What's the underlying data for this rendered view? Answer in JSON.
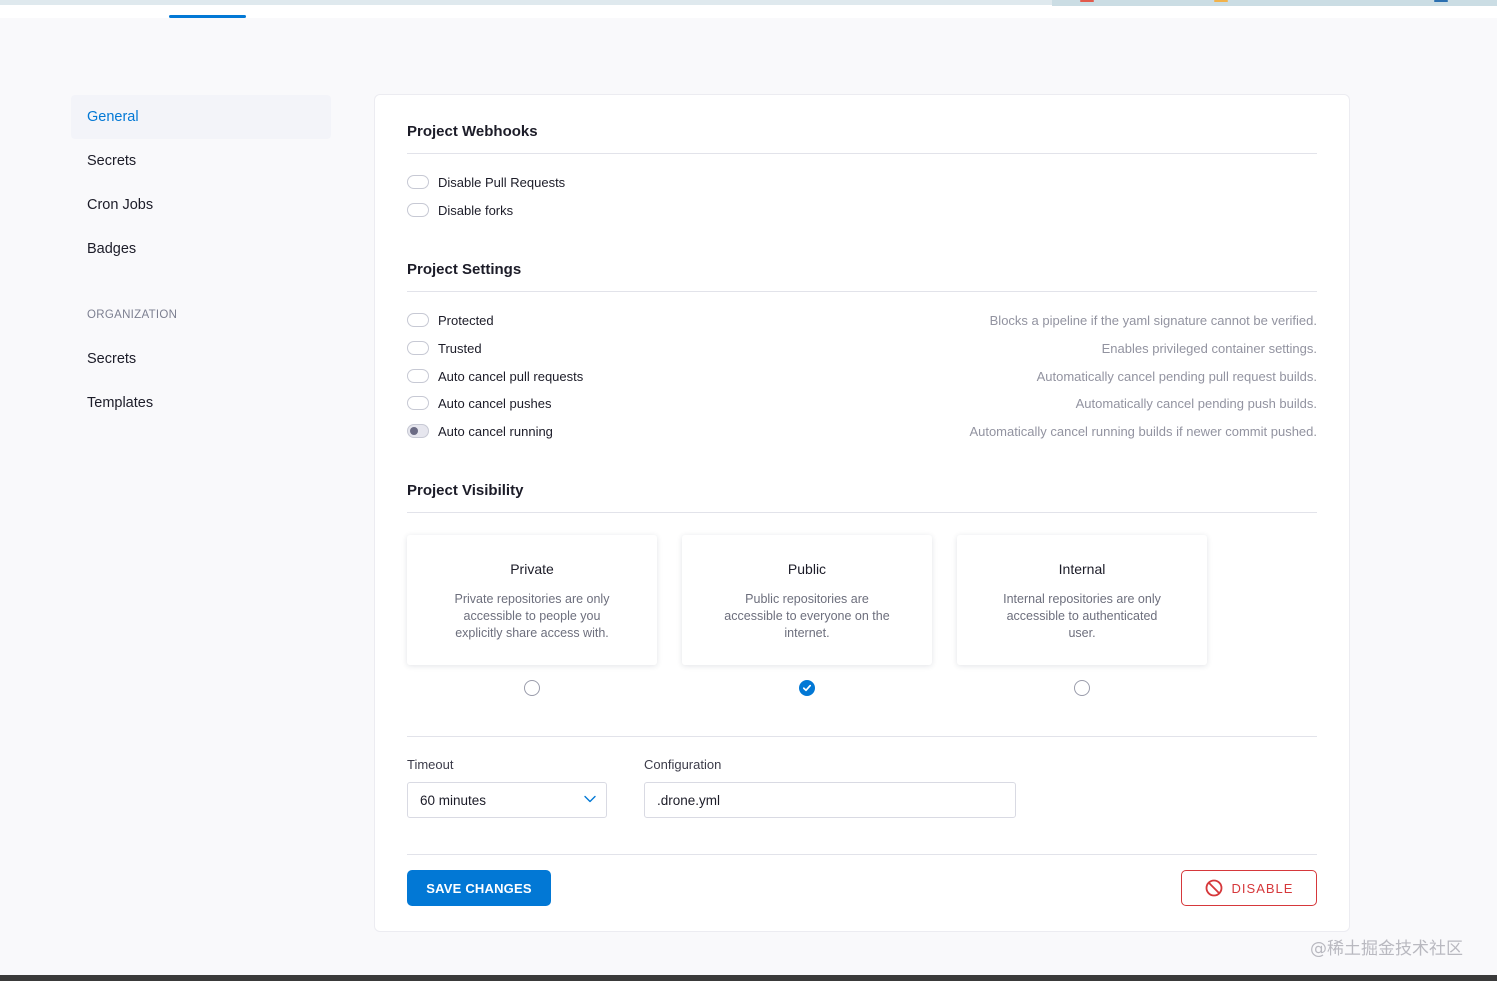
{
  "sidebar": {
    "items": [
      {
        "label": "General",
        "active": true
      },
      {
        "label": "Secrets"
      },
      {
        "label": "Cron Jobs"
      },
      {
        "label": "Badges"
      }
    ],
    "org_heading": "ORGANIZATION",
    "org_items": [
      {
        "label": "Secrets"
      },
      {
        "label": "Templates"
      }
    ]
  },
  "webhooks": {
    "title": "Project Webhooks",
    "toggles": [
      {
        "label": "Disable Pull Requests",
        "on": false
      },
      {
        "label": "Disable forks",
        "on": false
      }
    ]
  },
  "settings": {
    "title": "Project Settings",
    "toggles": [
      {
        "label": "Protected",
        "desc": "Blocks a pipeline if the yaml signature cannot be verified.",
        "on": false
      },
      {
        "label": "Trusted",
        "desc": "Enables privileged container settings.",
        "on": false
      },
      {
        "label": "Auto cancel pull requests",
        "desc": "Automatically cancel pending pull request builds.",
        "on": false
      },
      {
        "label": "Auto cancel pushes",
        "desc": "Automatically cancel pending push builds.",
        "on": false
      },
      {
        "label": "Auto cancel running",
        "desc": "Automatically cancel running builds if newer commit pushed.",
        "on": true
      }
    ]
  },
  "visibility": {
    "title": "Project Visibility",
    "options": [
      {
        "title": "Private",
        "desc": "Private repositories are only accessible to people you explicitly share access with.",
        "selected": false
      },
      {
        "title": "Public",
        "desc": "Public repositories are accessible to everyone on the internet.",
        "selected": true
      },
      {
        "title": "Internal",
        "desc": "Internal repositories are only accessible to authenticated user.",
        "selected": false
      }
    ]
  },
  "timeout": {
    "label": "Timeout",
    "value": "60 minutes"
  },
  "configuration": {
    "label": "Configuration",
    "value": ".drone.yml"
  },
  "actions": {
    "save_label": "SAVE CHANGES",
    "disable_label": "DISABLE"
  },
  "watermark": "@稀土掘金技术社区",
  "colors": {
    "accent": "#0278d5",
    "danger": "#d6383b"
  }
}
